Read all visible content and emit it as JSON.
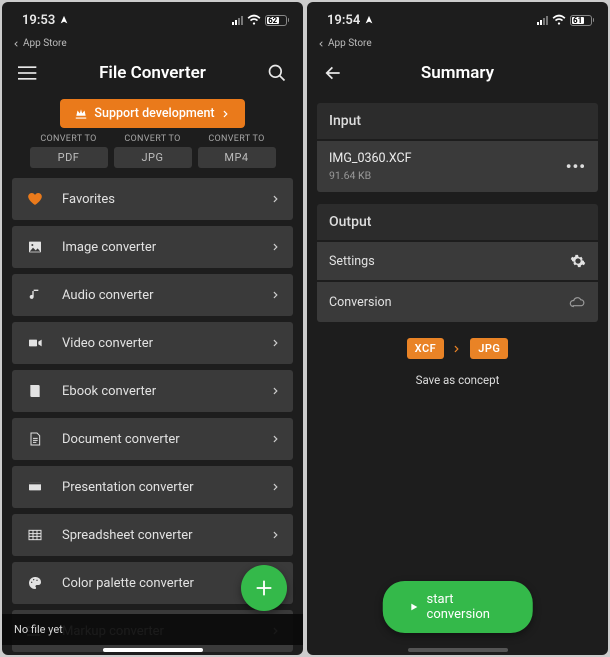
{
  "left": {
    "status": {
      "time": "19:53",
      "battery": "62",
      "back": "App Store"
    },
    "header": {
      "title": "File Converter"
    },
    "support": "Support development",
    "chips": {
      "label": "CONVERT TO",
      "items": [
        "PDF",
        "JPG",
        "MP4"
      ]
    },
    "rows": [
      {
        "label": "Favorites",
        "icon": "heart"
      },
      {
        "label": "Image converter",
        "icon": "image"
      },
      {
        "label": "Audio converter",
        "icon": "music"
      },
      {
        "label": "Video converter",
        "icon": "video"
      },
      {
        "label": "Ebook converter",
        "icon": "book"
      },
      {
        "label": "Document converter",
        "icon": "doc"
      },
      {
        "label": "Presentation converter",
        "icon": "pres"
      },
      {
        "label": "Spreadsheet converter",
        "icon": "sheet"
      },
      {
        "label": "Color palette converter",
        "icon": "palette"
      },
      {
        "label": "Markup converter",
        "icon": "markup"
      }
    ],
    "toast": "No file yet"
  },
  "right": {
    "status": {
      "time": "19:54",
      "battery": "61",
      "back": "App Store"
    },
    "header": {
      "title": "Summary"
    },
    "input": {
      "section": "Input",
      "fileName": "IMG_0360.XCF",
      "fileSize": "91.64 KB"
    },
    "output": {
      "section": "Output",
      "settings": "Settings",
      "conversion": "Conversion",
      "srcFmt": "XCF",
      "dstFmt": "JPG",
      "concept": "Save as concept"
    },
    "start": "start conversion"
  }
}
